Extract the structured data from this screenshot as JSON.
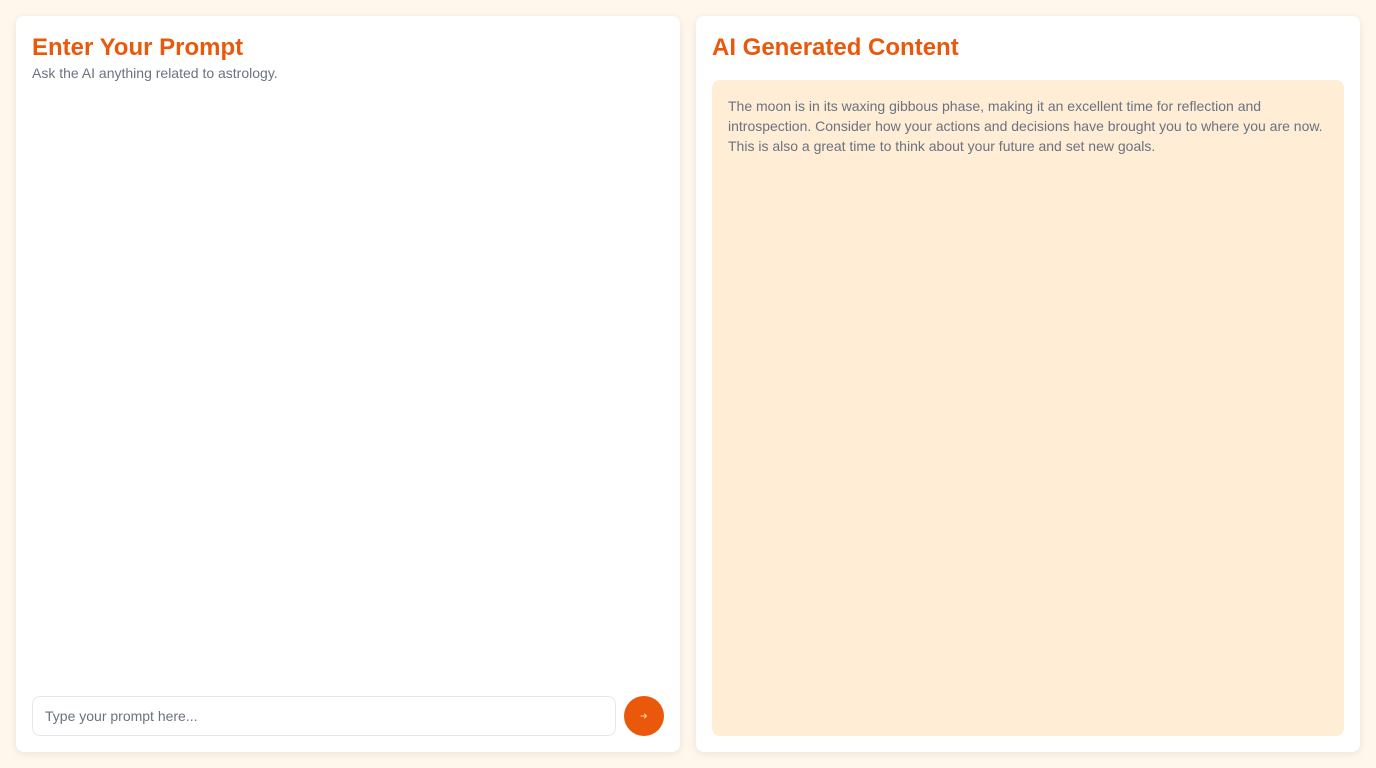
{
  "prompt_panel": {
    "title": "Enter Your Prompt",
    "subtitle": "Ask the AI anything related to astrology.",
    "input_placeholder": "Type your prompt here...",
    "input_value": "",
    "send_icon": "arrow-right-icon"
  },
  "output_panel": {
    "title": "AI Generated Content",
    "content": "The moon is in its waxing gibbous phase, making it an excellent time for reflection and introspection. Consider how your actions and decisions have brought you to where you are now. This is also a great time to think about your future and set new goals."
  },
  "colors": {
    "page_background": "#fff6ec",
    "accent": "#ea580c",
    "output_background": "#ffedd5",
    "muted_text": "#6b7280"
  }
}
